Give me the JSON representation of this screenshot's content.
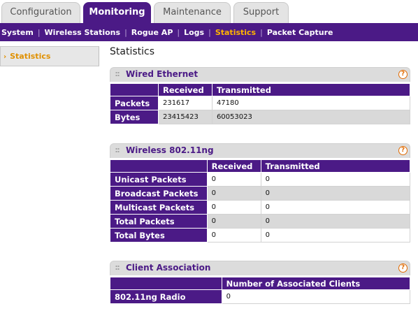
{
  "tabs": [
    {
      "label": "Configuration",
      "active": false
    },
    {
      "label": "Monitoring",
      "active": true
    },
    {
      "label": "Maintenance",
      "active": false
    },
    {
      "label": "Support",
      "active": false
    }
  ],
  "subnav": [
    {
      "label": "System",
      "active": false
    },
    {
      "label": "Wireless Stations",
      "active": false
    },
    {
      "label": "Rogue AP",
      "active": false
    },
    {
      "label": "Logs",
      "active": false
    },
    {
      "label": "Statistics",
      "active": true
    },
    {
      "label": "Packet Capture",
      "active": false
    }
  ],
  "leftnav": {
    "item": "Statistics",
    "bullet": "›"
  },
  "page_title": "Statistics",
  "help_glyph": "?",
  "wired": {
    "title": "Wired Ethernet",
    "headers": [
      "Received",
      "Transmitted"
    ],
    "rows": [
      {
        "label": "Packets",
        "received": "231617",
        "transmitted": "47180"
      },
      {
        "label": "Bytes",
        "received": "23415423",
        "transmitted": "60053023"
      }
    ]
  },
  "wireless": {
    "title": "Wireless 802.11ng",
    "headers": [
      "Received",
      "Transmitted"
    ],
    "rows": [
      {
        "label": "Unicast Packets",
        "received": "0",
        "transmitted": "0"
      },
      {
        "label": "Broadcast Packets",
        "received": "0",
        "transmitted": "0"
      },
      {
        "label": "Multicast Packets",
        "received": "0",
        "transmitted": "0"
      },
      {
        "label": "Total Packets",
        "received": "0",
        "transmitted": "0"
      },
      {
        "label": "Total Bytes",
        "received": "0",
        "transmitted": "0"
      }
    ]
  },
  "clients": {
    "title": "Client Association",
    "header": "Number of Associated Clients",
    "rows": [
      {
        "label": "802.11ng Radio",
        "value": "0"
      }
    ]
  },
  "colors": {
    "brand": "#4b1a86",
    "accent": "#ffb400",
    "help": "#e06a00"
  }
}
